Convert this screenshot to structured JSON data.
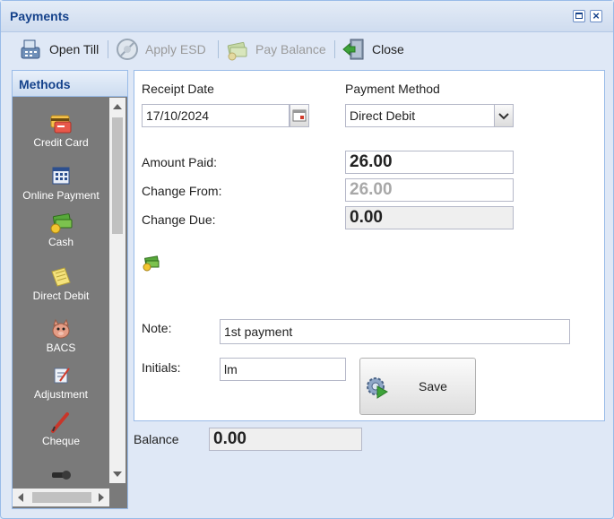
{
  "window": {
    "title": "Payments"
  },
  "toolbar": {
    "open_till": "Open Till",
    "apply_esd": "Apply ESD",
    "pay_balance": "Pay Balance",
    "close": "Close"
  },
  "methods": {
    "header": "Methods",
    "items": [
      {
        "label": "Credit Card",
        "icon": "credit-card-icon"
      },
      {
        "label": "Online Payment",
        "icon": "online-payment-icon"
      },
      {
        "label": "Cash",
        "icon": "cash-icon"
      },
      {
        "label": "Direct Debit",
        "icon": "direct-debit-icon"
      },
      {
        "label": "BACS",
        "icon": "bacs-icon"
      },
      {
        "label": "Adjustment",
        "icon": "adjustment-icon"
      },
      {
        "label": "Cheque",
        "icon": "cheque-icon"
      }
    ]
  },
  "form": {
    "receipt_date_label": "Receipt Date",
    "receipt_date_value": "17/10/2024",
    "payment_method_label": "Payment Method",
    "payment_method_value": "Direct Debit",
    "amount_paid_label": "Amount Paid:",
    "amount_paid_value": "26.00",
    "change_from_label": "Change From:",
    "change_from_value": "26.00",
    "change_due_label": "Change Due:",
    "change_due_value": "0.00",
    "note_label": "Note:",
    "note_value": "1st payment",
    "initials_label": "Initials:",
    "initials_value": "lm",
    "save_label": "Save"
  },
  "balance": {
    "label": "Balance",
    "value": "0.00"
  },
  "colors": {
    "accent": "#15428b",
    "panel_border": "#99bbe8",
    "background": "#dfe8f6"
  }
}
